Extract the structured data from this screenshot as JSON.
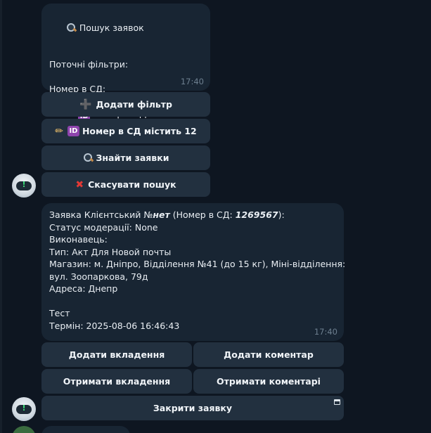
{
  "search_message": {
    "title": "Пошук заявок",
    "filters_heading": "Поточні фільтри:",
    "field_label": "Номер в СД:",
    "filter_item_icon": "ID",
    "filter_item_text": "Номер в СД містить 12",
    "time": "17:40"
  },
  "search_keyboard": {
    "add_filter": "Додати фільтр",
    "edit_filter_icon": "ID",
    "edit_filter": "Номер в СД містить 12",
    "find_requests": "Знайти заявки",
    "cancel_search": "Скасувати пошук"
  },
  "request_message": {
    "line1_prefix": "Заявка Клієнтський №",
    "line1_number": "нет",
    "line1_mid": " (Номер в СД: ",
    "line1_sd": "1269567",
    "line1_suffix": "):",
    "moderation": "Статус модерації: None",
    "executor": "Виконавець:",
    "type": "Тип: Акт Для Новой почты",
    "shop_line1": "Магазин: м. Дніпро, Відділення №41 (до 15 кг), Міні-відділення:",
    "shop_line2": "вул. Зоопаркова, 79д",
    "address": "Адреса: Днепр",
    "note": "Тест",
    "deadline": "Термін: 2025-08-06 16:46:43",
    "time": "17:40"
  },
  "request_keyboard": {
    "add_attachment": "Додати вкладення",
    "add_comment": "Додати коментар",
    "get_attachments": "Отримати вкладення",
    "get_comments": "Отримати коментарі",
    "close_request": "Закрити заявку"
  },
  "colors": {
    "background": "#0e1621",
    "bubble": "#182533",
    "button": "#22303f",
    "id_emoji": "#8e44ad",
    "cancel_cross": "#e53935"
  }
}
